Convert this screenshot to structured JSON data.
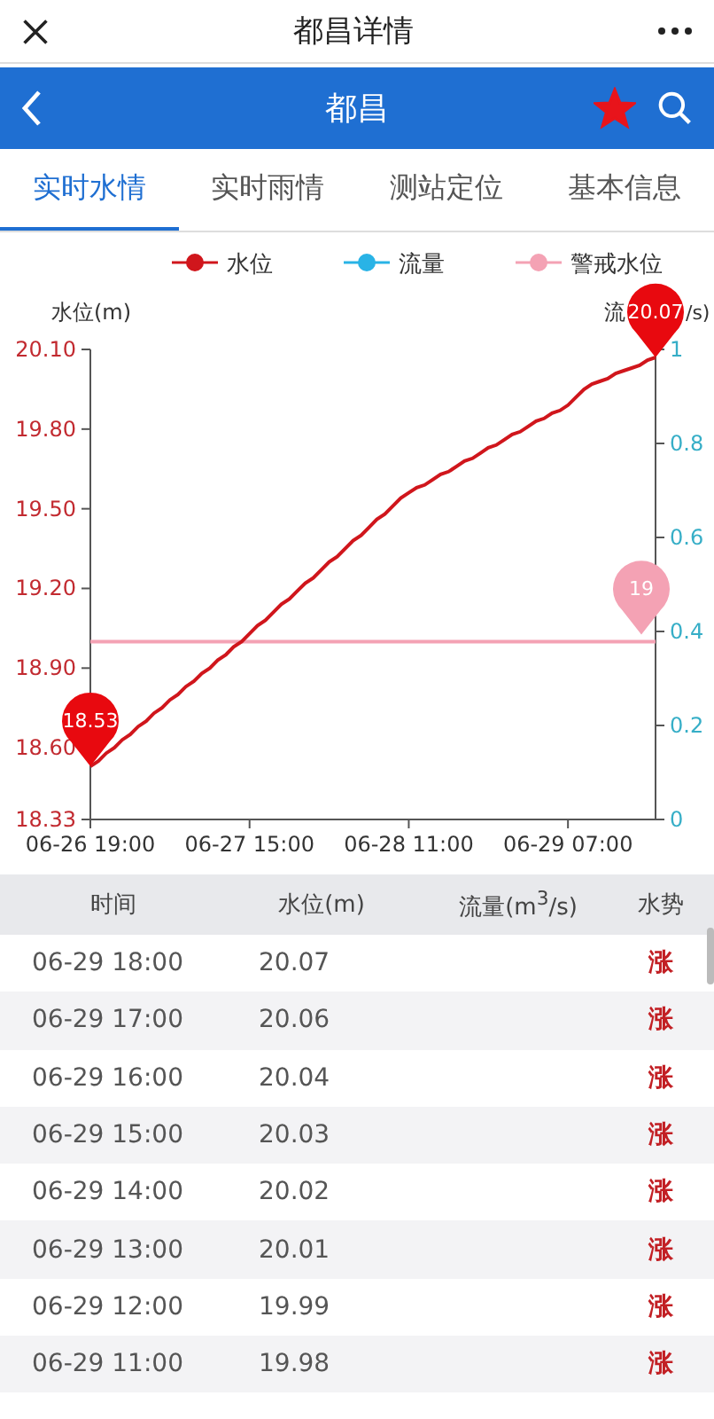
{
  "title_bar": {
    "title": "都昌详情"
  },
  "nav_bar": {
    "title": "都昌",
    "favorite": true
  },
  "tabs": [
    {
      "label": "实时水情",
      "selected": true
    },
    {
      "label": "实时雨情",
      "selected": false
    },
    {
      "label": "测站定位",
      "selected": false
    },
    {
      "label": "基本信息",
      "selected": false
    }
  ],
  "chart": {
    "extra_legend": [
      {
        "name": "流量",
        "color": "#29b3e6"
      },
      {
        "name": "警戒水位",
        "color": "#f4a2b4"
      }
    ],
    "right_axis_label_parts": [
      "流",
      "/s)"
    ],
    "chart_data": {
      "type": "line",
      "ylabel": "水位(m)",
      "ylim": [
        18.33,
        20.1
      ],
      "yticks": [
        {
          "value": 18.33,
          "label": "18.33"
        },
        {
          "value": 18.6,
          "label": "18.60"
        },
        {
          "value": 18.9,
          "label": "18.90"
        },
        {
          "value": 19.2,
          "label": "19.20"
        },
        {
          "value": 19.5,
          "label": "19.50"
        },
        {
          "value": 19.8,
          "label": "19.80"
        },
        {
          "value": 20.1,
          "label": "20.10"
        }
      ],
      "y2lim": [
        0,
        1
      ],
      "y2ticks": [
        {
          "value": 0,
          "label": "0"
        },
        {
          "value": 0.2,
          "label": "0.2"
        },
        {
          "value": 0.4,
          "label": "0.4"
        },
        {
          "value": 0.6,
          "label": "0.6"
        },
        {
          "value": 0.8,
          "label": "0.8"
        },
        {
          "value": 1,
          "label": "1"
        }
      ],
      "categories": [
        "06-26 19:00",
        null,
        null,
        null,
        null,
        null,
        null,
        null,
        null,
        null,
        null,
        null,
        null,
        null,
        null,
        null,
        null,
        null,
        null,
        null,
        "06-27 15:00",
        null,
        null,
        null,
        null,
        null,
        null,
        null,
        null,
        null,
        null,
        null,
        null,
        null,
        null,
        null,
        null,
        null,
        null,
        null,
        "06-28 11:00",
        null,
        null,
        null,
        null,
        null,
        null,
        null,
        null,
        null,
        null,
        null,
        null,
        null,
        null,
        null,
        null,
        null,
        null,
        null,
        "06-29 07:00",
        null,
        null,
        null,
        null,
        null,
        null,
        null,
        null,
        null,
        null,
        null
      ],
      "series": [
        {
          "name": "水位",
          "color": "#d0161c",
          "values": [
            18.53,
            18.55,
            18.58,
            18.6,
            18.63,
            18.65,
            18.68,
            18.7,
            18.73,
            18.75,
            18.78,
            18.8,
            18.83,
            18.85,
            18.88,
            18.9,
            18.93,
            18.95,
            18.98,
            19.0,
            19.03,
            19.06,
            19.08,
            19.11,
            19.14,
            19.16,
            19.19,
            19.22,
            19.24,
            19.27,
            19.3,
            19.32,
            19.35,
            19.38,
            19.4,
            19.43,
            19.46,
            19.48,
            19.51,
            19.54,
            19.56,
            19.58,
            19.59,
            19.61,
            19.63,
            19.64,
            19.66,
            19.68,
            19.69,
            19.71,
            19.73,
            19.74,
            19.76,
            19.78,
            19.79,
            19.81,
            19.83,
            19.84,
            19.86,
            19.87,
            19.89,
            19.92,
            19.95,
            19.97,
            19.98,
            19.99,
            20.01,
            20.02,
            20.03,
            20.04,
            20.06,
            20.07
          ]
        }
      ],
      "ref_lines": [
        {
          "axis": "y",
          "value": 19,
          "label": "19",
          "color": "#f4a2b4"
        }
      ],
      "annotations": [
        {
          "y": 18.53,
          "text": "18.53"
        },
        {
          "y": 20.07,
          "text": "20.07"
        }
      ]
    }
  },
  "table": {
    "columns": [
      "时间",
      "水位(m)",
      "流量(m$^{3}$/s)",
      "水势"
    ],
    "rows": [
      {
        "time": "06-29 18:00",
        "level": "20.07",
        "trend": "涨"
      },
      {
        "time": "06-29 17:00",
        "level": "20.06",
        "trend": "涨"
      },
      {
        "time": "06-29 16:00",
        "level": "20.04",
        "trend": "涨"
      },
      {
        "time": "06-29 15:00",
        "level": "20.03",
        "trend": "涨"
      },
      {
        "time": "06-29 14:00",
        "level": "20.02",
        "trend": "涨"
      },
      {
        "time": "06-29 13:00",
        "level": "20.01",
        "trend": "涨"
      },
      {
        "time": "06-29 12:00",
        "level": "19.99",
        "trend": "涨"
      },
      {
        "time": "06-29 11:00",
        "level": "19.98",
        "trend": "涨"
      }
    ]
  }
}
